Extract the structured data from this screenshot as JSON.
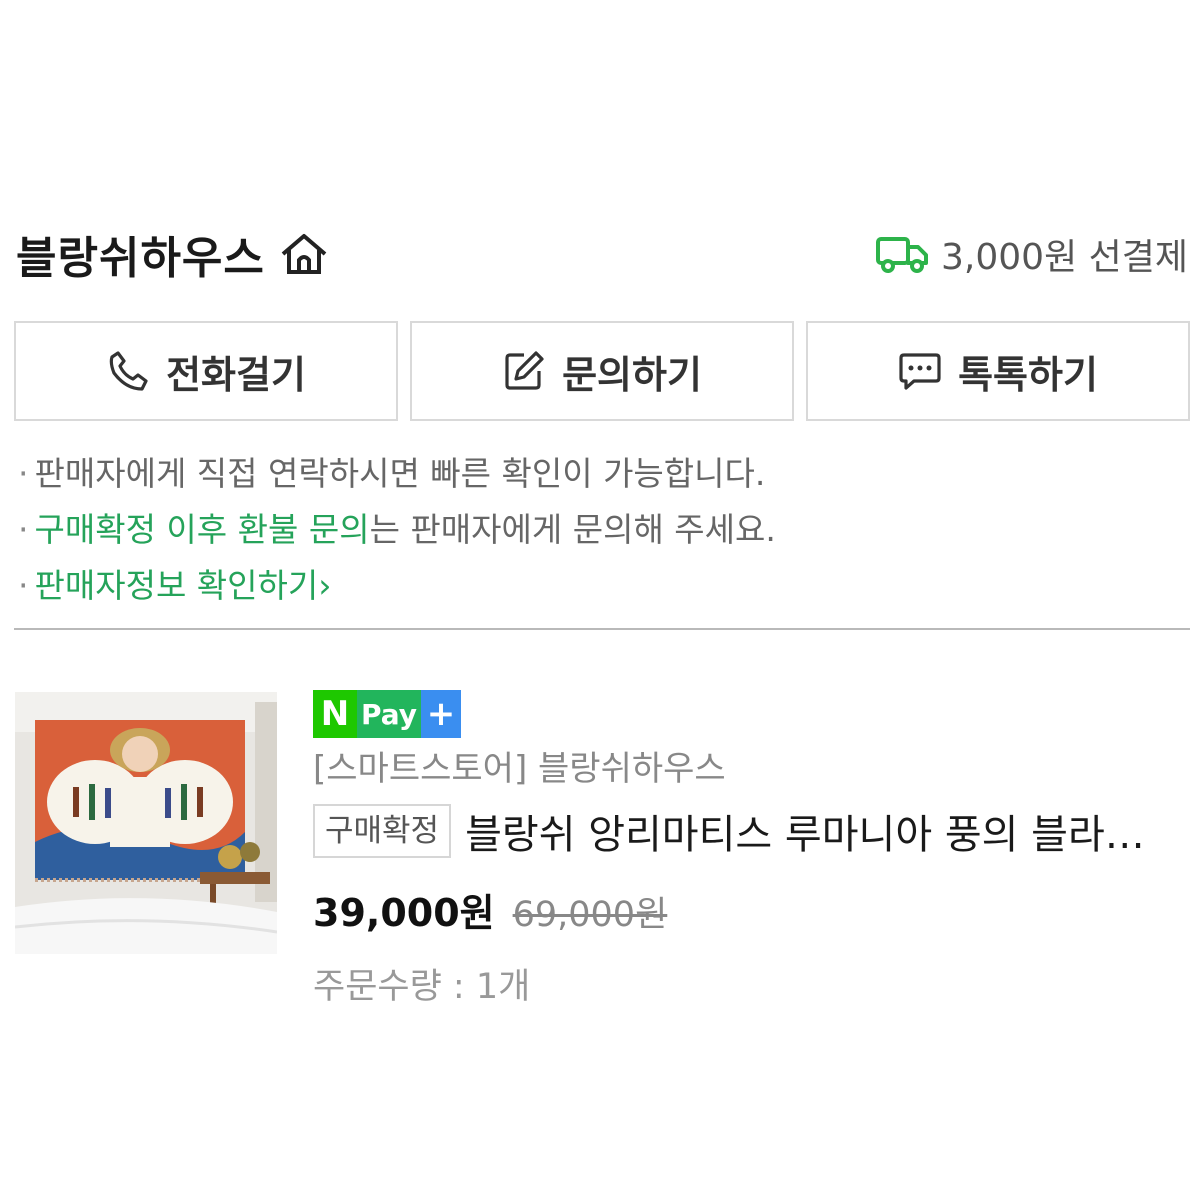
{
  "store": {
    "name": "블랑쉬하우스",
    "shipping_text": "3,000원 선결제"
  },
  "actions": [
    {
      "label": "전화걸기",
      "icon": "phone-icon"
    },
    {
      "label": "문의하기",
      "icon": "edit-icon"
    },
    {
      "label": "톡톡하기",
      "icon": "chat-icon"
    }
  ],
  "notices": {
    "line1": "판매자에게 직접 연락하시면 빠른 확인이 가능합니다.",
    "line2_highlight": "구매확정 이후 환불 문의",
    "line2_rest": "는 판매자에게 문의해 주세요.",
    "line3_link": "판매자정보 확인하기",
    "line3_chevron": "›",
    "bullet": "·"
  },
  "product": {
    "npay_n": "N",
    "npay_pay": "Pay",
    "npay_plus": "+",
    "store_line": "[스마트스토어] 블랑쉬하우스",
    "status_badge": "구매확정",
    "title": "블랑쉬 앙리마티스 루마니아 풍의 블라우스 패브릭 포스터",
    "price": "39,000원",
    "original_price": "69,000원",
    "quantity": "주문수량 : 1개"
  },
  "colors": {
    "accent_green": "#25a35a",
    "npay_green": "#1ec800",
    "npay_blue": "#3a8ef0"
  }
}
